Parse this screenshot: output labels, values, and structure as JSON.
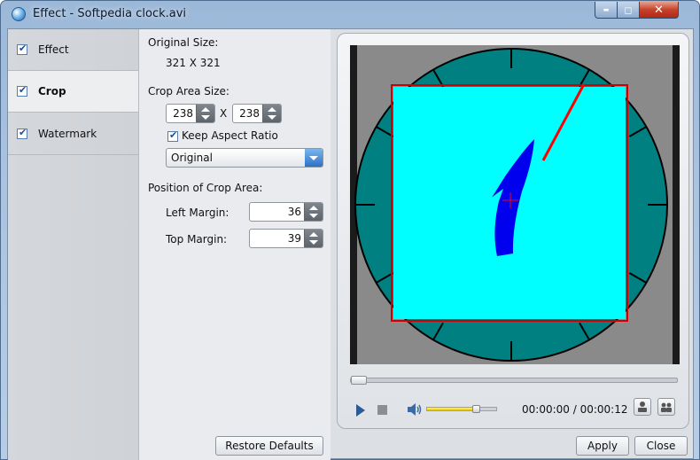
{
  "window": {
    "title": "Effect - Softpedia clock.avi",
    "controls": {
      "minimize": "▬",
      "maximize": "◻",
      "close": "✕"
    }
  },
  "nav": {
    "items": [
      {
        "label": "Effect",
        "checked": true,
        "active": false
      },
      {
        "label": "Crop",
        "checked": true,
        "active": true
      },
      {
        "label": "Watermark",
        "checked": true,
        "active": false
      }
    ]
  },
  "crop": {
    "original_size_label": "Original Size:",
    "original_size_value": "321 X 321",
    "crop_area_size_label": "Crop Area Size:",
    "width": "238",
    "separator": "X",
    "height": "238",
    "keep_aspect_label": "Keep Aspect Ratio",
    "keep_aspect_checked": true,
    "aspect_select_value": "Original",
    "position_label": "Position of Crop Area:",
    "left_margin_label": "Left Margin:",
    "left_margin": "36",
    "top_margin_label": "Top Margin:",
    "top_margin": "39",
    "restore_defaults": "Restore Defaults"
  },
  "player": {
    "time": "00:00:00 / 00:00:12",
    "seek_progress": 0.0,
    "volume_level": 0.7
  },
  "footer": {
    "apply": "Apply",
    "close": "Close"
  },
  "colors": {
    "crop_fill": "#00ffff",
    "clock_face": "#008080",
    "hand": "#ff0000",
    "digit": "#0000ee"
  }
}
